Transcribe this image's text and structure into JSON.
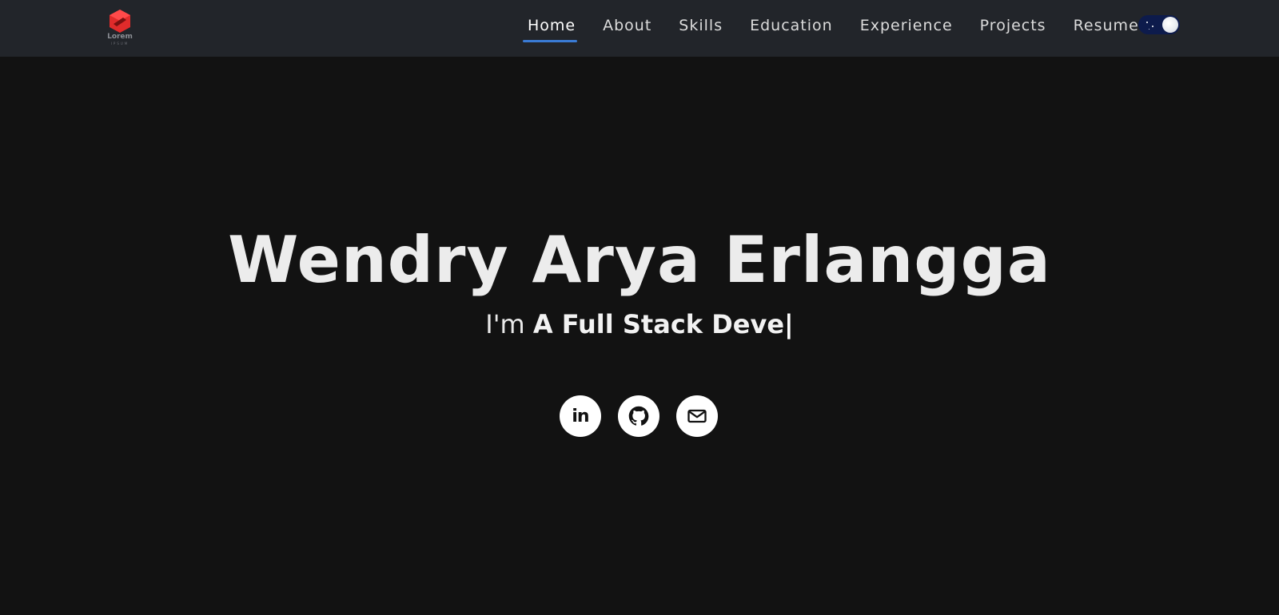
{
  "brand": {
    "logo_text": "Lorem",
    "logo_sub": "IPSUM",
    "logo_color": "#e02b2b"
  },
  "nav": {
    "items": [
      {
        "label": "Home",
        "active": true
      },
      {
        "label": "About"
      },
      {
        "label": "Skills"
      },
      {
        "label": "Education"
      },
      {
        "label": "Experience"
      },
      {
        "label": "Projects"
      },
      {
        "label": "Resume"
      }
    ],
    "active_color": "#3a7bd5",
    "theme_toggle": {
      "icon": "moon-toggle",
      "state": "dark"
    }
  },
  "hero": {
    "name": "Wendry Arya Erlangga",
    "prefix": "I'm ",
    "typed": "A Full Stack Deve",
    "cursor": "|"
  },
  "socials": [
    {
      "icon": "linkedin-icon",
      "label": "in"
    },
    {
      "icon": "github-icon"
    },
    {
      "icon": "mail-icon"
    }
  ]
}
